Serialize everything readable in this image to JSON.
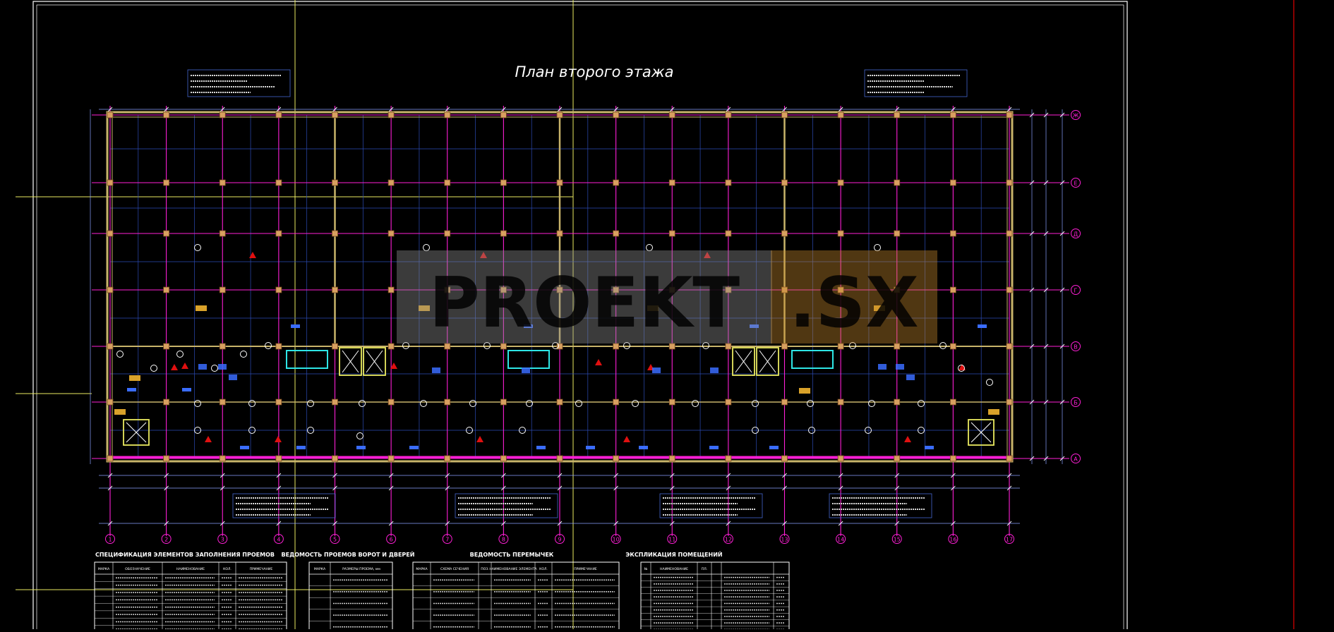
{
  "title": "План второго этажа",
  "watermark": {
    "left": "PROEKT",
    "right": ".SX"
  },
  "axes": {
    "numbers": [
      "1",
      "2",
      "3",
      "4",
      "5",
      "6",
      "7",
      "8",
      "9",
      "10",
      "11",
      "12",
      "13",
      "14",
      "15",
      "16",
      "17"
    ],
    "letters": [
      "Ж",
      "Е",
      "Д",
      "Г",
      "В",
      "Б",
      "А"
    ]
  },
  "tables": {
    "spec": {
      "title": "СПЕЦИФИКАЦИЯ ЭЛЕМЕНТОВ ЗАПОЛНЕНИЯ ПРОЕМОВ",
      "headers": [
        "МАРКА",
        "ОБОЗНАЧЕНИЕ",
        "НАИМЕНОВАНИЕ",
        "КОЛ.",
        "ПРИМЕЧАНИЕ"
      ]
    },
    "gates": {
      "title": "ВЕДОМОСТЬ ПРОЕМОВ ВОРОТ И ДВЕРЕЙ",
      "headers": [
        "МАРКА",
        "РАЗМЕРЫ ПРОЕМА, мм"
      ]
    },
    "lintels": {
      "title": "ВЕДОМОСТЬ ПЕРЕМЫЧЕК",
      "headers": [
        "МАРКА",
        "СХЕМА СЕЧЕНИЯ",
        "ПОЗ.",
        "НАИМЕНОВАНИЕ ЭЛЕМЕНТА",
        "КОЛ.",
        "ПРИМЕЧАНИЕ"
      ]
    },
    "rooms": {
      "title": "ЭКСПЛИКАЦИЯ ПОМЕЩЕНИЙ",
      "headers": [
        "№",
        "НАИМЕНОВАНИЕ",
        "ПЛ."
      ]
    }
  },
  "colors": {
    "axis": "#ff1fd6",
    "wall": "#c8b46a",
    "grid": "#2c4bb4",
    "column": "#d8a060",
    "frame": "#ffffff",
    "yellow_guide": "#eaea60",
    "red_line": "#e00000",
    "cyan": "#2ee6e6",
    "label_blue": "#3a6cff"
  }
}
